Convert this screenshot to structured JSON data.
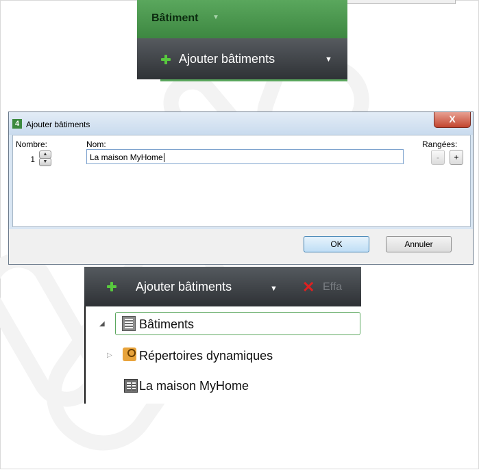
{
  "ribbon": {
    "section_title": "Bâtiment",
    "add_label": "Ajouter bâtiments",
    "icons": [
      "plus-icon",
      "chevron-down-icon"
    ]
  },
  "dialog": {
    "title": "Ajouter bâtiments",
    "close_label": "X",
    "count_label": "Nombre:",
    "count_value": "1",
    "name_label": "Nom:",
    "name_value": "La maison MyHome",
    "rows_label": "Rangées:",
    "row_minus": "-",
    "row_plus": "+",
    "ok_label": "OK",
    "cancel_label": "Annuler"
  },
  "panel": {
    "add_label": "Ajouter bâtiments",
    "delete_partial": "Effa",
    "tree": [
      {
        "label": "Bâtiments",
        "expanded": true,
        "selected": true,
        "icon": "building-icon"
      },
      {
        "label": "Répertoires dynamiques",
        "expanded": false,
        "icon": "dynamic-folder-icon"
      },
      {
        "label": "La maison MyHome",
        "icon": "house-building-icon"
      }
    ]
  },
  "colors": {
    "ribbon_green": "#4a9a4e",
    "toolbar_dark": "#3a3e42",
    "plus_green": "#58c93e",
    "close_red": "#c2452f",
    "delete_red": "#e02020"
  }
}
